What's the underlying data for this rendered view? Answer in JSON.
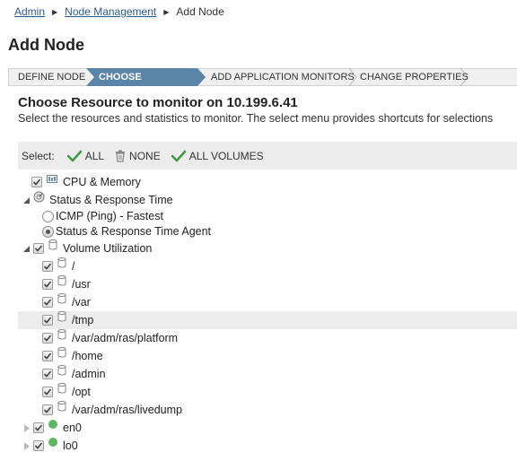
{
  "breadcrumb": {
    "items": [
      "Admin",
      "Node Management"
    ],
    "current": "Add Node"
  },
  "page_title": "Add Node",
  "wizard": {
    "steps": [
      "DEFINE NODE",
      "CHOOSE RESOURCES",
      "ADD APPLICATION MONITORS",
      "CHANGE PROPERTIES"
    ],
    "active": "CHOOSE RESOURCES"
  },
  "content": {
    "heading": "Choose Resource to monitor on 10.199.6.41",
    "subheading": "Select the resources and statistics to monitor. The select menu provides shortcuts for selections"
  },
  "select_bar": {
    "label": "Select:",
    "all": "ALL",
    "none": "NONE",
    "all_volumes": "ALL VOLUMES"
  },
  "tree": {
    "cpu": "CPU & Memory",
    "status": "Status & Response Time",
    "icmp": "ICMP (Ping) - Fastest",
    "agent": "Status & Response Time Agent",
    "volume": "Volume Utilization",
    "volumes": [
      "/",
      "/usr",
      "/var",
      "/tmp",
      "/var/adm/ras/platform",
      "/home",
      "/admin",
      "/opt",
      "/var/adm/ras/livedump"
    ],
    "interfaces": [
      "en0",
      "lo0"
    ],
    "selected_radio": "Status & Response Time Agent",
    "status_color": "#5cb85c",
    "accent_color": "#5a84a8"
  }
}
